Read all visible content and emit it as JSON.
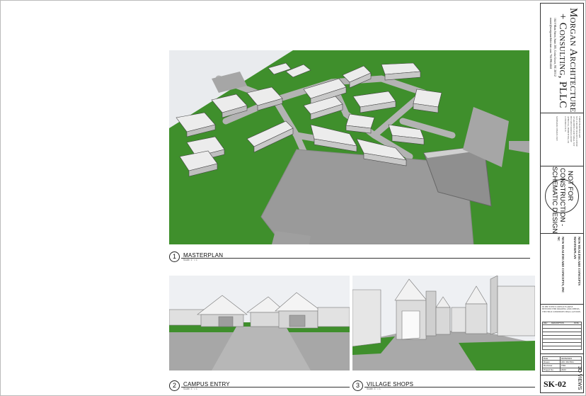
{
  "views": [
    {
      "number": "1",
      "title": "MASTERPLAN",
      "scale": "Scale: 1\" = 1'"
    },
    {
      "number": "2",
      "title": "CAMPUS ENTRY",
      "scale": "Scale: 1\" = 1'"
    },
    {
      "number": "3",
      "title": "VILLAGE SHOPS",
      "scale": "Scale: 1\" = 1'"
    }
  ],
  "firm": {
    "name_line1": "Morgan Architecture",
    "name_line2": "+ Consulting, PLLC",
    "address": "104 S Main Street, Suite 205, Cedar Grove, NC 28312",
    "contact": "ronnie@morganarchitecture.com 704.990.4444"
  },
  "license_notes": [
    "THESE DRAWINGS ARE",
    "NOT A SIGNED SEALED LICENSE",
    "OF ARCHITECT AND SHALL NOT",
    "BE USED FOR REGULATORY",
    "APPROVAL, PERMITTING, OR",
    "CONSTRUCTION"
  ],
  "license_footer": "SCHEMATIC DESIGN ONLY",
  "stamp": {
    "line1": "NOT FOR",
    "line2": "CONSTRUCTION -",
    "line3": "SCHEMATIC DESIGN"
  },
  "project": {
    "name_line1": "NEW HEALTHCARE CONCEPTS",
    "name_line2": "MASTERPLAN",
    "client": "NEW HEALTHCARE CONCEPTS, INC",
    "location": "NC"
  },
  "copyright": "IN THE EVENT CONFLICTS ARISE BETWEEN THIS DRAWING AND OTHERS, THE FIELD CONDITIONS SHALL GOVERN.",
  "revisions_header": {
    "num": "REV",
    "description": "DESCRIPTION",
    "date": "DATE"
  },
  "sheet_info": [
    {
      "label": "Date",
      "value": "02/06/2023"
    },
    {
      "label": "Drawn",
      "value": "AM / RGTRH"
    },
    {
      "label": "Reviewer",
      "value": "TDH"
    },
    {
      "label": "Project No",
      "value": "2023"
    }
  ],
  "sheet_number": "SK-02",
  "sheet_title": "3D VIEWS",
  "colors": {
    "grass": "#3f8f2c",
    "grass_dark": "#2f7a20",
    "road": "#a9a9a9",
    "pad": "#999999",
    "roof": "#e9e9e9"
  }
}
